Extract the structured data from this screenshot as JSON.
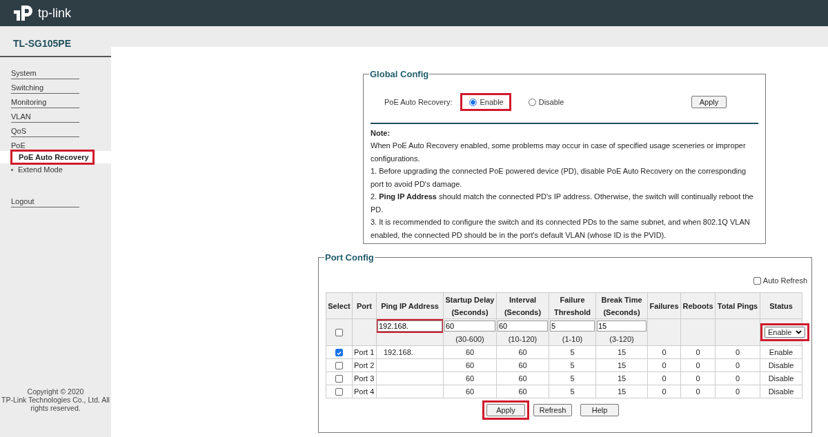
{
  "header": {
    "logo_text": "tp-link"
  },
  "sidebar": {
    "model": "TL-SG105PE",
    "items": [
      {
        "label": "System",
        "kind": "section",
        "selected": false,
        "highlighted": false
      },
      {
        "label": "Switching",
        "kind": "section",
        "selected": false,
        "highlighted": false
      },
      {
        "label": "Monitoring",
        "kind": "section",
        "selected": false,
        "highlighted": false
      },
      {
        "label": "VLAN",
        "kind": "section",
        "selected": false,
        "highlighted": false
      },
      {
        "label": "QoS",
        "kind": "section",
        "selected": false,
        "highlighted": false
      },
      {
        "label": "PoE",
        "kind": "group",
        "selected": false,
        "highlighted": false
      },
      {
        "label": "PoE Auto Recovery",
        "kind": "sub",
        "selected": true,
        "highlighted": true
      },
      {
        "label": "Extend Mode",
        "kind": "sub",
        "selected": false,
        "highlighted": false
      },
      {
        "label": "Logout",
        "kind": "logout",
        "selected": false,
        "highlighted": false
      }
    ],
    "copyright_lines": [
      "Copyright © 2020",
      "TP-Link Technologies Co., Ltd. All",
      "rights reserved."
    ]
  },
  "global_config": {
    "title": "Global Config",
    "label": "PoE Auto Recovery:",
    "options": [
      {
        "label": "Enable",
        "selected": true,
        "highlighted": true
      },
      {
        "label": "Disable",
        "selected": false,
        "highlighted": false
      }
    ],
    "apply_button": "Apply",
    "note_title": "Note:",
    "note_lines": [
      "When PoE Auto Recovery enabled, some problems may occur in case of specified usage sceneries or improper configurations.",
      "1. Before upgrading the connected PoE powered device (PD), disable PoE Auto Recovery on the corresponding port to avoid PD's damage.",
      "2. **Ping IP Address** should match the connected PD's IP address. Otherwise, the switch will continually reboot the PD.",
      "3. It is recommended to configure the switch and its connected PDs to the same subnet, and when 802.1Q VLAN enabled, the connected PD should be in the port's default VLAN (whose ID is the PVID)."
    ]
  },
  "port_config": {
    "title": "Port Config",
    "auto_refresh": {
      "label": "Auto Refresh",
      "checked": false
    },
    "columns": [
      {
        "lines": [
          "Select"
        ]
      },
      {
        "lines": [
          "Port"
        ]
      },
      {
        "lines": [
          "Ping IP Address"
        ]
      },
      {
        "lines": [
          "Startup Delay",
          "(Seconds)"
        ]
      },
      {
        "lines": [
          "Interval",
          "(Seconds)"
        ]
      },
      {
        "lines": [
          "Failure",
          "Threshold"
        ]
      },
      {
        "lines": [
          "Break Time",
          "(Seconds)"
        ]
      },
      {
        "lines": [
          "Failures"
        ]
      },
      {
        "lines": [
          "Reboots"
        ]
      },
      {
        "lines": [
          "Total Pings"
        ]
      },
      {
        "lines": [
          "Status"
        ]
      }
    ],
    "edit_row": {
      "checked": false,
      "fields": [
        {
          "value": "192.168.",
          "highlighted": true
        },
        {
          "value": "60",
          "highlighted": false,
          "range": "(30-600)"
        },
        {
          "value": "60",
          "highlighted": false,
          "range": "(10-120)"
        },
        {
          "value": "5",
          "highlighted": false,
          "range": "(1-10)"
        },
        {
          "value": "15",
          "highlighted": false,
          "range": "(3-120)"
        }
      ],
      "status": {
        "value": "Enable",
        "highlighted": true
      }
    },
    "rows": [
      {
        "checked": true,
        "port": "Port 1",
        "ip": "192.168.",
        "startup": "60",
        "interval": "60",
        "threshold": "5",
        "break": "15",
        "failures": "0",
        "reboots": "0",
        "pings": "0",
        "status": "Enable"
      },
      {
        "checked": false,
        "port": "Port 2",
        "startup": "60",
        "interval": "60",
        "threshold": "5",
        "break": "15",
        "failures": "0",
        "reboots": "0",
        "pings": "0",
        "status": "Disable"
      },
      {
        "checked": false,
        "port": "Port 3",
        "startup": "60",
        "interval": "60",
        "threshold": "5",
        "break": "15",
        "failures": "0",
        "reboots": "0",
        "pings": "0",
        "status": "Disable"
      },
      {
        "checked": false,
        "port": "Port 4",
        "startup": "60",
        "interval": "60",
        "threshold": "5",
        "break": "15",
        "failures": "0",
        "reboots": "0",
        "pings": "0",
        "status": "Disable"
      }
    ],
    "buttons": [
      {
        "label": "Apply",
        "highlighted": true
      },
      {
        "label": "Refresh",
        "highlighted": false
      },
      {
        "label": "Help",
        "highlighted": false
      }
    ]
  }
}
